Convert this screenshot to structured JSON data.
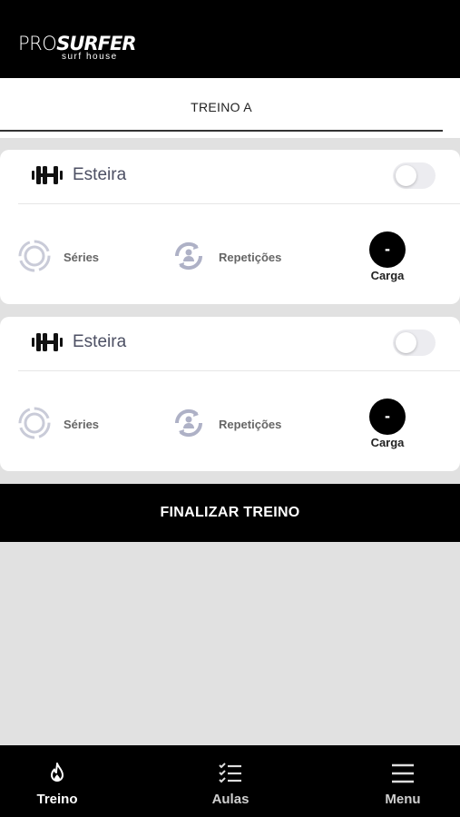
{
  "header": {
    "logo_pro": "PRO",
    "logo_surfer": "SURFER",
    "logo_subtitle": "surf house"
  },
  "tab": {
    "label": "TREINO A"
  },
  "exercises": [
    {
      "name": "Esteira",
      "toggle_on": false,
      "series_label": "Séries",
      "reps_label": "Repetições",
      "load_value": "-",
      "load_label": "Carga"
    },
    {
      "name": "Esteira",
      "toggle_on": false,
      "series_label": "Séries",
      "reps_label": "Repetições",
      "load_value": "-",
      "load_label": "Carga"
    }
  ],
  "finish_button": "FINALIZAR TREINO",
  "bottom_nav": [
    {
      "label": "Treino",
      "icon": "flame-icon",
      "active": true
    },
    {
      "label": "Aulas",
      "icon": "checklist-icon",
      "active": false
    },
    {
      "label": "Menu",
      "icon": "hamburger-icon",
      "active": false
    }
  ],
  "colors": {
    "accent": "#000000",
    "background": "#e1e1e1",
    "card": "#ffffff",
    "muted_icon": "#aeb1c6"
  }
}
